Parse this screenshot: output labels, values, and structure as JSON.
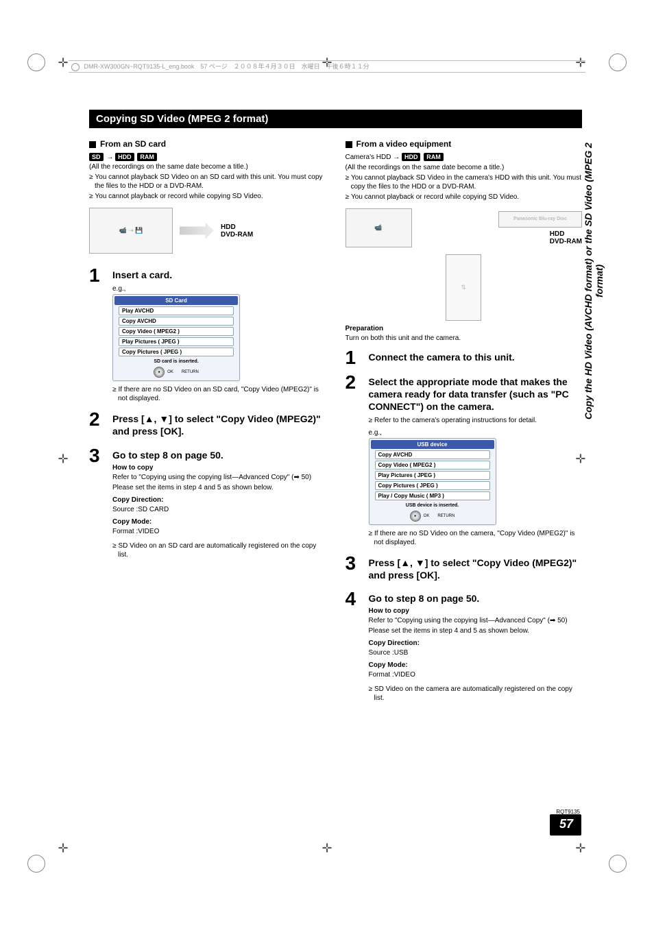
{
  "header_line": "DMR-XW300GN~RQT9135-L_eng.book　57 ページ　２００８年４月３０日　水曜日　午後６時１１分",
  "section_title": "Copying SD Video (MPEG 2 format)",
  "side_text": "Copy the HD Video (AVCHD format) or the SD Video (MPEG 2 format)",
  "rqt": "RQT9135",
  "page_no": "57",
  "left": {
    "heading": "From an SD card",
    "badges": {
      "sd": "SD",
      "arrow": "→",
      "hdd": "HDD",
      "ram": "RAM"
    },
    "p1": "(All the recordings on the same date become a title.)",
    "b1": "You cannot playback SD Video on an SD card with this unit. You must copy the files to the HDD or a DVD-RAM.",
    "b2": "You cannot playback or record while copying SD Video.",
    "illus_hdd": "HDD",
    "illus_dvd": "DVD-RAM",
    "step1_title": "Insert a card.",
    "eg": "e.g.,",
    "menu_title": "SD Card",
    "menu_items": [
      "Play AVCHD",
      "Copy AVCHD",
      "Copy Video ( MPEG2 )",
      "Play Pictures ( JPEG )",
      "Copy Pictures ( JPEG )"
    ],
    "menu_status": "SD card is inserted.",
    "menu_ok": "OK",
    "menu_return": "RETURN",
    "note1": "If there are no SD Video on an SD card, \"Copy Video (MPEG2)\" is not displayed.",
    "step2_title": "Press [▲, ▼] to select \"Copy Video (MPEG2)\" and press [OK].",
    "step3_title": "Go to step 8 on page 50.",
    "howto": "How to copy",
    "howto_p1": "Refer to \"Copying using the copying list—Advanced Copy\" (➡ 50)",
    "howto_p2": "Please set the items in step 4 and 5 as shown below.",
    "cd_label": "Copy Direction:",
    "cd_value": "Source :SD CARD",
    "cm_label": "Copy Mode:",
    "cm_value": "Format :VIDEO",
    "note2": "SD Video on an SD card are automatically registered on the copy list."
  },
  "right": {
    "heading": "From a video equipment",
    "camera_hdd_label": "Camera's HDD →",
    "badges": {
      "hdd": "HDD",
      "ram": "RAM"
    },
    "p1": "(All the recordings on the same date become a title.)",
    "b1": "You cannot playback SD Video in the camera's HDD with this unit. You must copy the files to the HDD or a DVD-RAM.",
    "b2": "You cannot playback or record while copying SD Video.",
    "illus_hdd": "HDD",
    "illus_dvd": "DVD-RAM",
    "recorder_text": "Panasonic Blu-ray Disc",
    "prep_label": "Preparation",
    "prep_text": "Turn on both this unit and the camera.",
    "step1_title": "Connect the camera to this unit.",
    "step2_title": "Select the appropriate mode that makes the camera ready for data transfer (such as \"PC CONNECT\") on the camera.",
    "step2_sub": "Refer to the camera's operating instructions for detail.",
    "eg": "e.g.,",
    "menu_title": "USB device",
    "menu_items": [
      "Copy AVCHD",
      "Copy Video ( MPEG2 )",
      "Play Pictures ( JPEG )",
      "Copy Pictures ( JPEG )",
      "Play / Copy Music ( MP3 )"
    ],
    "menu_status": "USB device is inserted.",
    "menu_ok": "OK",
    "menu_return": "RETURN",
    "note1": "If there are no SD Video on the camera, \"Copy Video (MPEG2)\" is not displayed.",
    "step3_title": "Press [▲, ▼] to select \"Copy Video (MPEG2)\" and press [OK].",
    "step4_title": "Go to step 8 on page 50.",
    "howto": "How to copy",
    "howto_p1": "Refer to \"Copying using the copying list—Advanced Copy\" (➡ 50)",
    "howto_p2": "Please set the items in step 4 and 5 as shown below.",
    "cd_label": "Copy Direction:",
    "cd_value": "Source :USB",
    "cm_label": "Copy Mode:",
    "cm_value": "Format :VIDEO",
    "note2": "SD Video on the camera are automatically registered on the copy list."
  }
}
